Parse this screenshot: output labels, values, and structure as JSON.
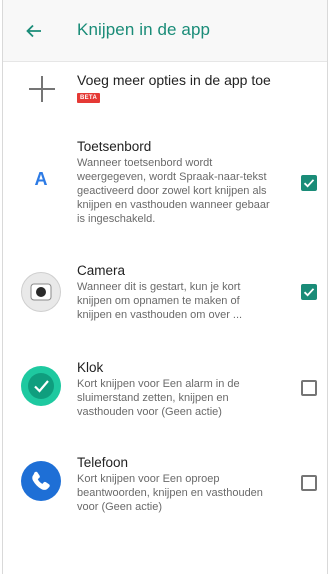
{
  "app_bar": {
    "title": "Knijpen in de app"
  },
  "add_option": {
    "label": "Voeg meer opties in de app toe",
    "badge": "BETA"
  },
  "items": [
    {
      "title": "Toetsenbord",
      "description": "Wanneer toetsenbord wordt weergegeven, wordt Spraak-naar-tekst geactiveerd door zowel kort knijpen als knijpen en vasthouden wanneer gebaar is ingeschakeld.",
      "icon": "keyboard-icon",
      "icon_letter": "A",
      "checked": true
    },
    {
      "title": "Camera",
      "description": "Wanneer dit is gestart, kun je kort knijpen om opnamen te maken of knijpen en vasthouden om over ...",
      "icon": "camera-icon",
      "checked": true
    },
    {
      "title": "Klok",
      "description": "Kort knijpen voor Een alarm in de sluimerstand zetten, knijpen en vasthouden voor (Geen actie)",
      "icon": "clock-icon",
      "checked": false
    },
    {
      "title": "Telefoon",
      "description": "Kort knijpen voor Een oproep beantwoorden, knijpen en vasthouden voor (Geen actie)",
      "icon": "phone-icon",
      "checked": false
    }
  ],
  "colors": {
    "accent": "#1a8c78",
    "beta": "#e53935",
    "clock": "#1ec9a0",
    "phone": "#1e6fd6"
  }
}
